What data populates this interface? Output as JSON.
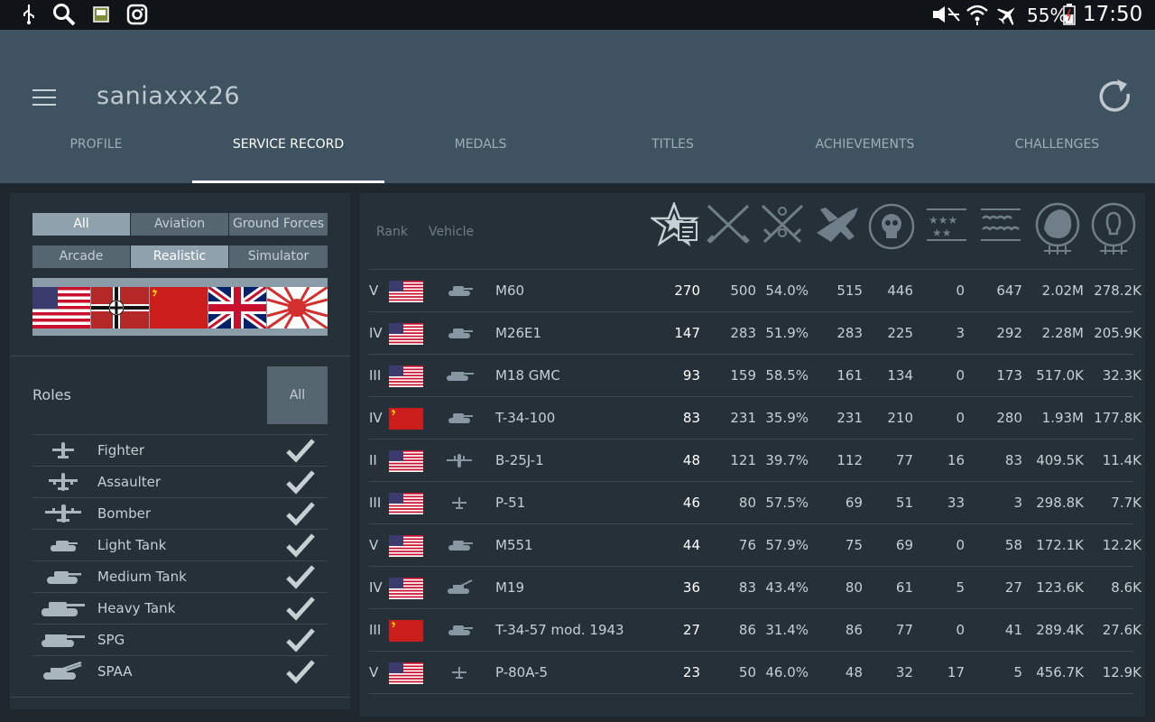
{
  "status_bar": {
    "battery": "55%",
    "time": "17:50"
  },
  "app": {
    "title": "saniaxxx26"
  },
  "tabs": [
    "PROFILE",
    "SERVICE RECORD",
    "MEDALS",
    "TITLES",
    "ACHIEVEMENTS",
    "CHALLENGES"
  ],
  "active_tab": "SERVICE RECORD",
  "filters": {
    "type": [
      "All",
      "Aviation",
      "Ground Forces"
    ],
    "type_selected": "All",
    "mode": [
      "Arcade",
      "Realistic",
      "Simulator"
    ],
    "mode_selected": "Realistic",
    "nations": [
      "usa",
      "germany",
      "ussr",
      "britain",
      "japan"
    ]
  },
  "roles": {
    "label": "Roles",
    "all_label": "All",
    "items": [
      {
        "label": "Fighter",
        "icon": "fighter-icon",
        "checked": true
      },
      {
        "label": "Assaulter",
        "icon": "assaulter-icon",
        "checked": true
      },
      {
        "label": "Bomber",
        "icon": "bomber-icon",
        "checked": true
      },
      {
        "label": "Light Tank",
        "icon": "light-tank-icon",
        "checked": true
      },
      {
        "label": "Medium Tank",
        "icon": "medium-tank-icon",
        "checked": true
      },
      {
        "label": "Heavy Tank",
        "icon": "heavy-tank-icon",
        "checked": true
      },
      {
        "label": "SPG",
        "icon": "spg-icon",
        "checked": true
      },
      {
        "label": "SPAA",
        "icon": "spaa-icon",
        "checked": true
      }
    ]
  },
  "table": {
    "headers": {
      "rank": "Rank",
      "vehicle": "Vehicle"
    },
    "stat_icons": [
      "battles-icon",
      "victories-icon",
      "win-rate-icon",
      "respawns-icon",
      "deaths-icon",
      "air-kills-icon",
      "ground-kills-icon",
      "ground-kills-stars-icon",
      "lion-icon",
      "research-icon"
    ],
    "rows": [
      {
        "rank": "V",
        "nation": "usa",
        "vicon": "tank",
        "name": "M60",
        "v": [
          "270",
          "500",
          "54.0%",
          "515",
          "446",
          "0",
          "647",
          "2.02M",
          "278.2K"
        ]
      },
      {
        "rank": "IV",
        "nation": "usa",
        "vicon": "tank",
        "name": "M26E1",
        "v": [
          "147",
          "283",
          "51.9%",
          "283",
          "225",
          "3",
          "292",
          "2.28M",
          "205.9K"
        ]
      },
      {
        "rank": "III",
        "nation": "usa",
        "vicon": "spg",
        "name": "M18 GMC",
        "v": [
          "93",
          "159",
          "58.5%",
          "161",
          "134",
          "0",
          "173",
          "517.0K",
          "32.3K"
        ]
      },
      {
        "rank": "IV",
        "nation": "ussr",
        "vicon": "tank",
        "name": "T-34-100",
        "v": [
          "83",
          "231",
          "35.9%",
          "231",
          "210",
          "0",
          "280",
          "1.93M",
          "177.8K"
        ]
      },
      {
        "rank": "II",
        "nation": "usa",
        "vicon": "bomber",
        "name": "B-25J-1",
        "v": [
          "48",
          "121",
          "39.7%",
          "112",
          "77",
          "16",
          "83",
          "409.5K",
          "11.4K"
        ]
      },
      {
        "rank": "III",
        "nation": "usa",
        "vicon": "fighter",
        "name": "P-51",
        "v": [
          "46",
          "80",
          "57.5%",
          "69",
          "51",
          "33",
          "3",
          "298.8K",
          "7.7K"
        ]
      },
      {
        "rank": "V",
        "nation": "usa",
        "vicon": "tank",
        "name": "M551",
        "v": [
          "44",
          "76",
          "57.9%",
          "75",
          "69",
          "0",
          "58",
          "172.1K",
          "12.2K"
        ]
      },
      {
        "rank": "IV",
        "nation": "usa",
        "vicon": "spaa",
        "name": "M19",
        "v": [
          "36",
          "83",
          "43.4%",
          "80",
          "61",
          "5",
          "27",
          "123.6K",
          "8.6K"
        ]
      },
      {
        "rank": "III",
        "nation": "ussr",
        "vicon": "tank",
        "name": "T-34-57 mod. 1943",
        "v": [
          "27",
          "86",
          "31.4%",
          "86",
          "77",
          "0",
          "41",
          "289.4K",
          "27.6K"
        ]
      },
      {
        "rank": "V",
        "nation": "usa",
        "vicon": "fighter",
        "name": "P-80A-5",
        "v": [
          "23",
          "50",
          "46.0%",
          "48",
          "32",
          "17",
          "5",
          "456.7K",
          "12.9K"
        ]
      }
    ]
  },
  "colors": {
    "appbar": "#3e5260",
    "panel": "#253038",
    "background": "#1f282e",
    "accent": "#ffffff"
  }
}
